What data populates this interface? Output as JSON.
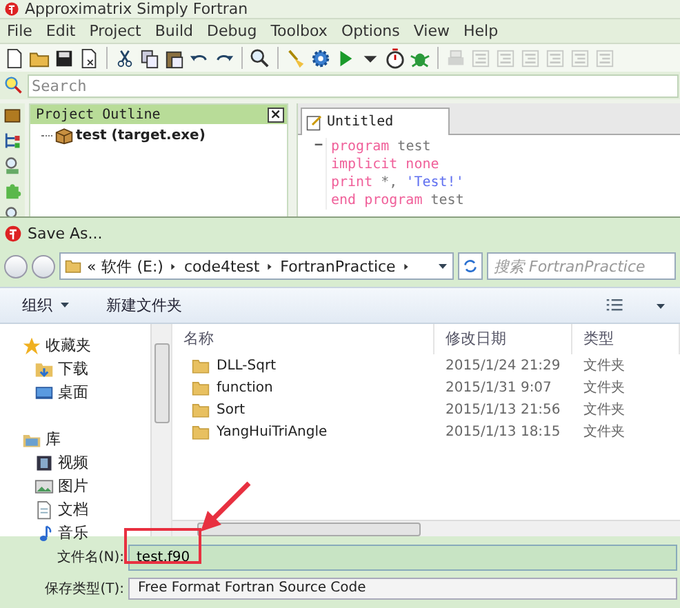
{
  "window": {
    "title": "Approximatrix Simply Fortran"
  },
  "menu": [
    "File",
    "Edit",
    "Project",
    "Build",
    "Debug",
    "Toolbox",
    "Options",
    "View",
    "Help"
  ],
  "toolbar": [
    {
      "kind": "page",
      "disabled": false
    },
    {
      "kind": "folder",
      "disabled": false
    },
    {
      "kind": "floppy",
      "disabled": false
    },
    {
      "kind": "close-page",
      "disabled": false
    },
    {
      "kind": "separator",
      "disabled": false
    },
    {
      "kind": "scissors",
      "disabled": false
    },
    {
      "kind": "copy",
      "disabled": false
    },
    {
      "kind": "clipboard",
      "disabled": false
    },
    {
      "kind": "undo",
      "disabled": false
    },
    {
      "kind": "redo",
      "disabled": false
    },
    {
      "kind": "separator",
      "disabled": false
    },
    {
      "kind": "magnifier",
      "disabled": false
    },
    {
      "kind": "separator",
      "disabled": false
    },
    {
      "kind": "broom",
      "disabled": false
    },
    {
      "kind": "gear",
      "disabled": false
    },
    {
      "kind": "play",
      "disabled": false
    },
    {
      "kind": "caret",
      "disabled": false
    },
    {
      "kind": "stopwatch",
      "disabled": false
    },
    {
      "kind": "bug",
      "disabled": false
    },
    {
      "kind": "separator",
      "disabled": false
    },
    {
      "kind": "printer",
      "disabled": true
    },
    {
      "kind": "format",
      "disabled": true
    },
    {
      "kind": "format",
      "disabled": true
    },
    {
      "kind": "format",
      "disabled": true
    },
    {
      "kind": "format",
      "disabled": true
    },
    {
      "kind": "format",
      "disabled": true
    },
    {
      "kind": "format",
      "disabled": true
    }
  ],
  "search": {
    "placeholder": "Search"
  },
  "side_icons": [
    {
      "kind": "box"
    },
    {
      "kind": "tree"
    },
    {
      "kind": "magnifier"
    },
    {
      "kind": "puzzle"
    },
    {
      "kind": "magnifier"
    }
  ],
  "project_outline": {
    "title": "Project Outline",
    "close": "×",
    "items": [
      {
        "label": "test (target.exe)"
      }
    ]
  },
  "editor": {
    "tabs": [
      {
        "label": "Untitled",
        "selected": true
      }
    ],
    "fold": "−",
    "lines": [
      [
        {
          "text": "program",
          "kind": "keyword"
        },
        {
          "text": " test",
          "kind": "plain"
        }
      ],
      [
        {
          "text": "implicit none",
          "kind": "keyword"
        }
      ],
      [
        {
          "text": "print",
          "kind": "keyword"
        },
        {
          "text": " *, ",
          "kind": "plain"
        },
        {
          "text": "'Test!'",
          "kind": "string"
        }
      ],
      [
        {
          "text": "end program",
          "kind": "keyword"
        },
        {
          "text": " test",
          "kind": "plain"
        }
      ]
    ]
  },
  "dialog": {
    "title": "Save As...",
    "breadcrumbs": [
      "«",
      "软件 (E:)",
      "code4test",
      "FortranPractice"
    ],
    "search": {
      "placeholder": "搜索 FortranPractice"
    },
    "toolbar": [
      {
        "label": "组织",
        "kind": "menu"
      },
      {
        "label": "新建文件夹",
        "kind": "button"
      }
    ],
    "nav": [
      {
        "label": "收藏夹",
        "kind": "star",
        "children": [
          {
            "label": "下载",
            "kind": "download"
          },
          {
            "label": "桌面",
            "kind": "desktop"
          }
        ]
      },
      {
        "label": "库",
        "kind": "library",
        "children": [
          {
            "label": "视频",
            "kind": "video"
          },
          {
            "label": "图片",
            "kind": "picture"
          },
          {
            "label": "文档",
            "kind": "document"
          },
          {
            "label": "音乐",
            "kind": "music"
          }
        ]
      }
    ],
    "columns": [
      "名称",
      "修改日期",
      "类型"
    ],
    "rows": [
      {
        "name": "DLL-Sqrt",
        "date": "2015/1/24 21:29",
        "type": "文件夹"
      },
      {
        "name": "function",
        "date": "2015/1/31 9:07",
        "type": "文件夹"
      },
      {
        "name": "Sort",
        "date": "2015/1/13 21:56",
        "type": "文件夹"
      },
      {
        "name": "YangHuiTriAngle",
        "date": "2015/1/13 18:15",
        "type": "文件夹"
      }
    ],
    "filename": {
      "label": "文件名(N):",
      "value": "test.f90"
    },
    "save_type": {
      "label": "保存类型(T):",
      "value": "Free Format Fortran Source Code"
    }
  }
}
